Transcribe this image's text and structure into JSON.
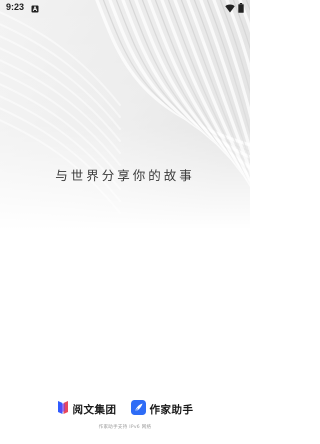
{
  "status_bar": {
    "time": "9:23",
    "notification_icon": "a-notification-icon",
    "wifi_icon": "wifi-icon",
    "battery_icon": "battery-icon"
  },
  "splash": {
    "slogan": "与世界分享你的故事"
  },
  "brands": [
    {
      "name": "阅文集团",
      "icon": "yuewen-logo-icon"
    },
    {
      "name": "作家助手",
      "icon": "feather-logo-icon"
    }
  ],
  "footer": {
    "note": "作家助手支持 IPv6 网络"
  },
  "colors": {
    "background": "#ffffff",
    "yuewen_blue": "#2f5bff",
    "yuewen_red": "#e8475c",
    "writer_blue": "#2e6cf6"
  }
}
